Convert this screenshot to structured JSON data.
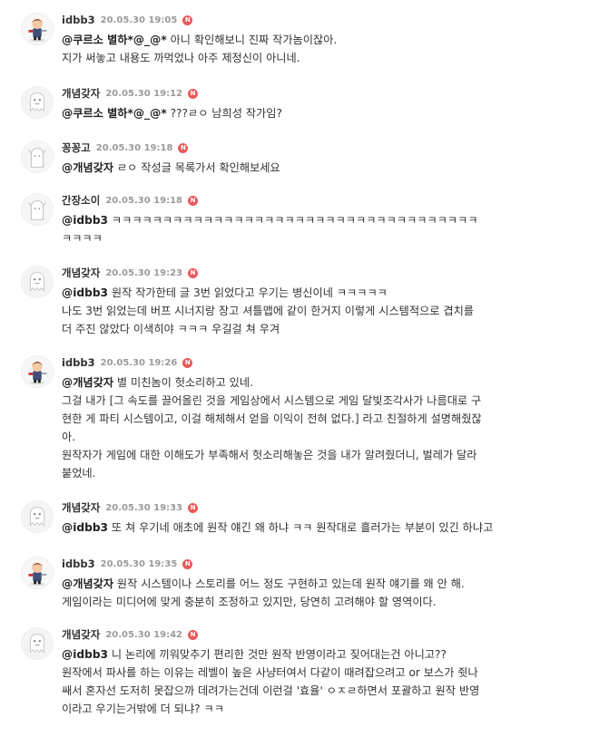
{
  "comments": [
    {
      "nick": "idbb3",
      "date": "20.05.30 19:05",
      "badge": "N",
      "avatar": "character-avatar-icon",
      "mention": "@쿠르소 별하*@_@*",
      "lines": [
        "아니 확인해보니 진짜 작가놈이잖아.",
        "지가 써놓고 내용도 까먹었나 아주 제정신이 아니네."
      ]
    },
    {
      "nick": "개념갖자",
      "date": "20.05.30 19:12",
      "badge": "N",
      "avatar": "ghost-avatar-icon",
      "mention": "@쿠르소 별하*@_@*",
      "lines": [
        "???ㄹㅇ 남희성 작가임?"
      ]
    },
    {
      "nick": "꽁꽁고",
      "date": "20.05.30 19:18",
      "badge": "N",
      "avatar": "default-avatar-icon",
      "mention": "@개념갖자",
      "lines": [
        "ㄹㅇ 작성글 목록가서 확인해보세요"
      ]
    },
    {
      "nick": "간장소이",
      "date": "20.05.30 19:18",
      "badge": "N",
      "avatar": "default-avatar-icon",
      "mention": "@idbb3",
      "lines": [
        "ㅋㅋㅋㅋㅋㅋㅋㅋㅋㅋㅋㅋㅋㅋㅋㅋㅋㅋㅋㅋㅋㅋㅋㅋㅋㅋㅋㅋㅋㅋㅋㅋㅋㅋㅋㅋ",
        "ㅋㅋㅋㅋ"
      ]
    },
    {
      "nick": "개념갖자",
      "date": "20.05.30 19:23",
      "badge": "N",
      "avatar": "ghost-avatar-icon",
      "mention": "@idbb3",
      "lines": [
        "원작 작가한테 글 3번 읽었다고 우기는 병신이네 ㅋㅋㅋㅋㅋ",
        "나도 3번 읽었는데 버프 시너지랑 장고 셔틀맵에 같이 한거지 이렇게 시스템적으로 겹치를",
        "더 주진 않았다 이색히야 ㅋㅋㅋ 우길걸 쳐 우겨"
      ]
    },
    {
      "nick": "idbb3",
      "date": "20.05.30 19:26",
      "badge": "N",
      "avatar": "character-avatar-icon",
      "mention": "@개념갖자",
      "lines": [
        "별 미친놈이 헛소리하고 있네.",
        "그걸 내가 [그 속도를 끌어올린 것을 게임상에서 시스템으로 게임 달빛조각사가 나름대로 구",
        "현한 게 파티 시스템이고, 이걸 해체해서 얻을 이익이 전혀 없다.] 라고 친절하게 설명해줬잖",
        "아.",
        "원작자가 게임에 대한 이해도가 부족해서 헛소리해놓은 것을 내가 알려줬더니, 벌레가 달라",
        "붙었네."
      ]
    },
    {
      "nick": "개념갖자",
      "date": "20.05.30 19:33",
      "badge": "N",
      "avatar": "ghost-avatar-icon",
      "mention": "@idbb3",
      "lines": [
        "또 쳐 우기네 애초에 원작 얘긴 왜 하냐 ㅋㅋ 원작대로 흘러가는 부분이 있긴 하냐고"
      ]
    },
    {
      "nick": "idbb3",
      "date": "20.05.30 19:35",
      "badge": "N",
      "avatar": "character-avatar-icon",
      "mention": "@개념갖자",
      "lines": [
        "원작 시스템이나 스토리를 어느 정도 구현하고 있는데 원작 얘기를 왜 안 해.",
        "게임이라는 미디어에 맞게 충분히 조정하고 있지만, 당연히 고려해야 할 영역이다."
      ]
    },
    {
      "nick": "개념갖자",
      "date": "20.05.30 19:42",
      "badge": "N",
      "avatar": "ghost-avatar-icon",
      "mention": "@idbb3",
      "lines": [
        "니 논리에 끼워맞추기 편리한 것만 원작 반영이라고 짖어대는건 아니고??",
        "원작에서 파사를 하는 이유는 레벨이 높은 사냥터여서 다같이 때려잡으려고 or 보스가 쥣나",
        "쌔서 혼자선 도저히 못잡으까 데려가는건데 이런걸 '효율' ㅇㅈㄹ하면서 포괄하고 원작 반영",
        "이라고 우기는거밖에 더 되냐? ㅋㅋ"
      ]
    }
  ]
}
